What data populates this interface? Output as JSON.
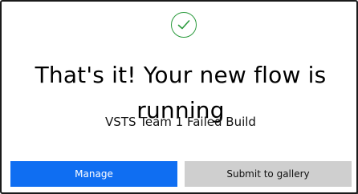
{
  "dialog": {
    "status_icon": "checkmark-circle-icon",
    "success_color": "#2a9a3c",
    "headline": "That's it! Your new flow is running",
    "flow_name": "VSTS Team 1 Failed Build"
  },
  "buttons": {
    "manage_label": "Manage",
    "manage_color": "#0f6ef2",
    "submit_label": "Submit to gallery",
    "submit_color": "#cfcfcf"
  }
}
